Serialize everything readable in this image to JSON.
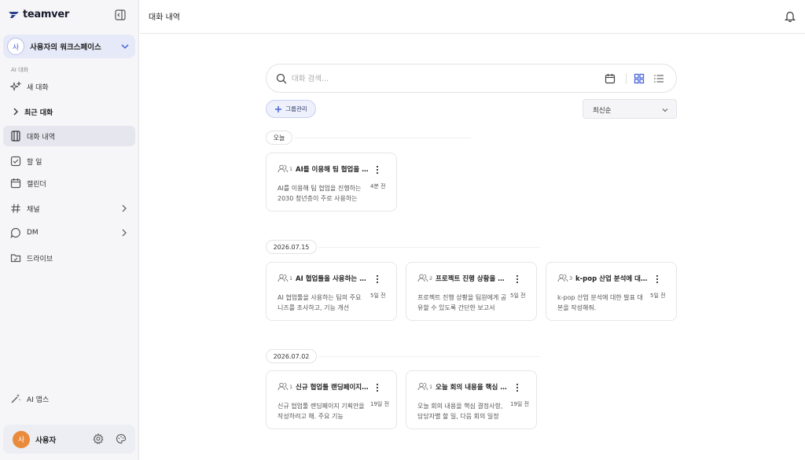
{
  "sidebar": {
    "logo_text": "teamver",
    "workspace": {
      "avatar": "사",
      "name": "사용자의 워크스페이스"
    },
    "section_label": "AI 대화",
    "items": [
      {
        "label": "새 대화",
        "icon": "sparkle-icon"
      },
      {
        "label": "최근 대화",
        "icon": "chevron-right-icon"
      },
      {
        "label": "대화 내역",
        "icon": "chat-history-icon"
      },
      {
        "label": "할 일",
        "icon": "checkbox-icon"
      },
      {
        "label": "캘린더",
        "icon": "calendar-icon"
      },
      {
        "label": "채널",
        "icon": "hash-icon"
      },
      {
        "label": "DM",
        "icon": "message-icon"
      },
      {
        "label": "드라이브",
        "icon": "folder-icon"
      },
      {
        "label": "AI 앱스",
        "icon": "magic-wand-icon"
      }
    ],
    "user": {
      "avatar": "사",
      "name": "사용자"
    }
  },
  "topbar": {
    "title": "대화 내역"
  },
  "search": {
    "placeholder": "대화 검색..."
  },
  "toolbar": {
    "group_label": "그룹관리",
    "sort_value": "최신순"
  },
  "colors": {
    "accent": "#4a63d8",
    "avatar_orange": "#e98a3c",
    "active_bg": "#e6e6ef"
  },
  "groups": [
    {
      "date": "오늘",
      "cards": [
        {
          "members": "1",
          "title": "AI를 이용해 팀 협업을 진행하는",
          "desc": "AI를 이용해 팀 협업을 진행하는 2030 청년층이 주로 사용하는",
          "time": "4분 전"
        }
      ]
    },
    {
      "date": "2026.07.15",
      "cards": [
        {
          "members": "1",
          "title": "AI 협업툴을 사용하는 팀의 주요",
          "desc": "AI 협업툴을 사용하는 팀의 주요 니즈를 조사하고, 기능 개선",
          "time": "5일 전"
        },
        {
          "members": "2",
          "title": "프로젝트 진행 상황을 팀원에게",
          "desc": "프로젝트 진행 상황을 팀원에게 공유할 수 있도록 간단한 보고서",
          "time": "5일 전"
        },
        {
          "members": "3",
          "title": "k-pop 산업 분석에 대한 발표",
          "desc": "k-pop 산업 분석에 대한 발표 대본을 작성해줘.",
          "time": "5일 전"
        }
      ]
    },
    {
      "date": "2026.07.02",
      "cards": [
        {
          "members": "1",
          "title": "신규 협업툴 랜딩페이지 기획안",
          "desc": "신규 협업툴 랜딩페이지 기획안을 작성하려고 해. 주요 기능",
          "time": "19일 전"
        },
        {
          "members": "1",
          "title": "오늘 회의 내용을 핵심 결정사항",
          "desc": "오늘 회의 내용을 핵심 결정사항, 담당자별 할 일, 다음 회의 일정",
          "time": "19일 전"
        }
      ]
    }
  ]
}
